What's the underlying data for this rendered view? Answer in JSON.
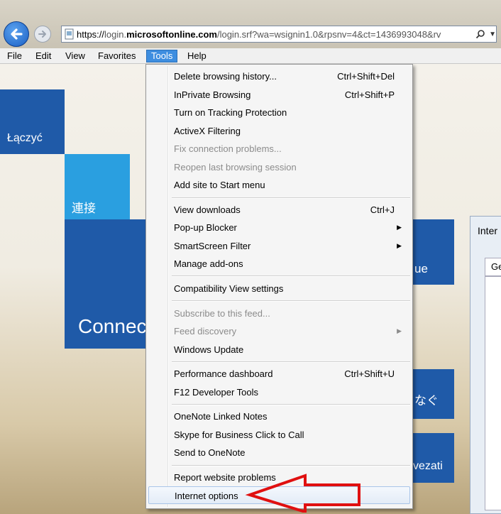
{
  "browser": {
    "url": {
      "scheme": "https://",
      "domain_prefix": "login.",
      "domain": "microsoftonline.com",
      "path": "/login.srf?wa=wsignin1.0&rpsnv=4&ct=1436993048&rv"
    },
    "icons": {
      "back": "back-arrow-icon",
      "forward": "forward-arrow-icon",
      "page": "page-icon",
      "search": "search-icon",
      "dropdown": "chevron-down-icon"
    }
  },
  "menubar": {
    "items": [
      "File",
      "Edit",
      "View",
      "Favorites",
      "Tools",
      "Help"
    ],
    "active": "Tools"
  },
  "page": {
    "tiles": {
      "polish": "Łączyć",
      "chinese": "連接",
      "english": "Connec",
      "partial_ue": "ue",
      "japanese": "なぐ",
      "partial_vezati": "vezati"
    },
    "dialog": {
      "title": "Inter",
      "tab": "Ge"
    }
  },
  "tools_menu": {
    "items": [
      {
        "label": "Delete browsing history...",
        "shortcut": "Ctrl+Shift+Del",
        "enabled": true
      },
      {
        "label": "InPrivate Browsing",
        "shortcut": "Ctrl+Shift+P",
        "enabled": true
      },
      {
        "label": "Turn on Tracking Protection",
        "shortcut": "",
        "enabled": true
      },
      {
        "label": "ActiveX Filtering",
        "shortcut": "",
        "enabled": true
      },
      {
        "label": "Fix connection problems...",
        "shortcut": "",
        "enabled": false
      },
      {
        "label": "Reopen last browsing session",
        "shortcut": "",
        "enabled": false
      },
      {
        "label": "Add site to Start menu",
        "shortcut": "",
        "enabled": true
      },
      {
        "label": "View downloads",
        "shortcut": "Ctrl+J",
        "enabled": true
      },
      {
        "label": "Pop-up Blocker",
        "shortcut": "",
        "submenu": true,
        "enabled": true
      },
      {
        "label": "SmartScreen Filter",
        "shortcut": "",
        "submenu": true,
        "enabled": true
      },
      {
        "label": "Manage add-ons",
        "shortcut": "",
        "enabled": true
      },
      {
        "label": "Compatibility View settings",
        "shortcut": "",
        "enabled": true
      },
      {
        "label": "Subscribe to this feed...",
        "shortcut": "",
        "enabled": false
      },
      {
        "label": "Feed discovery",
        "shortcut": "",
        "submenu": true,
        "enabled": false
      },
      {
        "label": "Windows Update",
        "shortcut": "",
        "enabled": true
      },
      {
        "label": "Performance dashboard",
        "shortcut": "Ctrl+Shift+U",
        "enabled": true
      },
      {
        "label": "F12 Developer Tools",
        "shortcut": "",
        "enabled": true
      },
      {
        "label": "OneNote Linked Notes",
        "shortcut": "",
        "enabled": true
      },
      {
        "label": "Skype for Business Click to Call",
        "shortcut": "",
        "enabled": true
      },
      {
        "label": "Send to OneNote",
        "shortcut": "",
        "enabled": true
      },
      {
        "label": "Report website problems",
        "shortcut": "",
        "enabled": true
      },
      {
        "label": "Internet options",
        "shortcut": "",
        "enabled": true,
        "highlighted": true
      }
    ],
    "submenu_icon": "triangle-right-icon"
  },
  "annotation": {
    "type": "red-arrow-outline",
    "color": "#e01010",
    "points_to": "Internet options"
  },
  "colors": {
    "menu_highlight": "#3e8ee0",
    "tile_dark": "#1f5aa8",
    "tile_light": "#2a9fe0",
    "annotation_red": "#e01010"
  }
}
